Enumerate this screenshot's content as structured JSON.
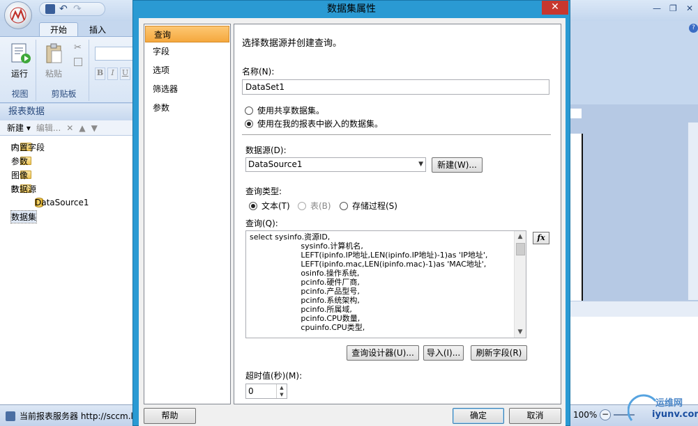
{
  "app": {
    "tabs": [
      "开始",
      "插入"
    ],
    "ribbon": {
      "run_label": "运行",
      "paste_label": "粘贴",
      "group_view": "视图",
      "group_clipboard": "剪贴板"
    },
    "data_pane": {
      "title": "报表数据",
      "new_label": "新建 ▾",
      "edit_label": "编辑...",
      "tree": [
        {
          "label": "内置字段",
          "expander": "+"
        },
        {
          "label": "参数",
          "expander": ""
        },
        {
          "label": "图像",
          "expander": ""
        },
        {
          "label": "数据源",
          "expander": "−"
        },
        {
          "label": "DataSource1",
          "expander": ""
        },
        {
          "label": "数据集",
          "expander": ""
        }
      ]
    },
    "status": {
      "text": "当前报表服务器 http://sccm.l",
      "zoom": "100%"
    },
    "watermark": {
      "line1": "运维网",
      "line2": "iyunv.com"
    }
  },
  "dialog": {
    "title": "数据集属性",
    "close_glyph": "✕",
    "nav": [
      "查询",
      "字段",
      "选项",
      "筛选器",
      "参数"
    ],
    "heading": "选择数据源并创建查询。",
    "name_label": "名称(N):",
    "name_value": "DataSet1",
    "option_shared": "使用共享数据集。",
    "option_embedded": "使用在我的报表中嵌入的数据集。",
    "datasource_label": "数据源(D):",
    "datasource_value": "DataSource1",
    "new_button": "新建(W)...",
    "query_type_label": "查询类型:",
    "query_type_text": "文本(T)",
    "query_type_table": "表(B)",
    "query_type_sp": "存储过程(S)",
    "query_label": "查询(Q):",
    "query_text": "select sysinfo.资源ID,\n                     sysinfo.计算机名,\n                     LEFT(ipinfo.IP地址,LEN(ipinfo.IP地址)-1)as 'IP地址',\n                     LEFT(ipinfo.mac,LEN(ipinfo.mac)-1)as 'MAC地址',\n                     osinfo.操作系统,\n                     pcinfo.硬件厂商,\n                     pcinfo.产品型号,\n                     pcinfo.系统架构,\n                     pcinfo.所属域,\n                     pcinfo.CPU数量,\n                     cpuinfo.CPU类型,",
    "fx_label": "fx",
    "query_designer_button": "查询设计器(U)...",
    "import_button": "导入(I)...",
    "refresh_button": "刷新字段(R)",
    "timeout_label": "超时值(秒)(M):",
    "timeout_value": "0",
    "help_button": "帮助",
    "ok_button": "确定",
    "cancel_button": "取消"
  }
}
